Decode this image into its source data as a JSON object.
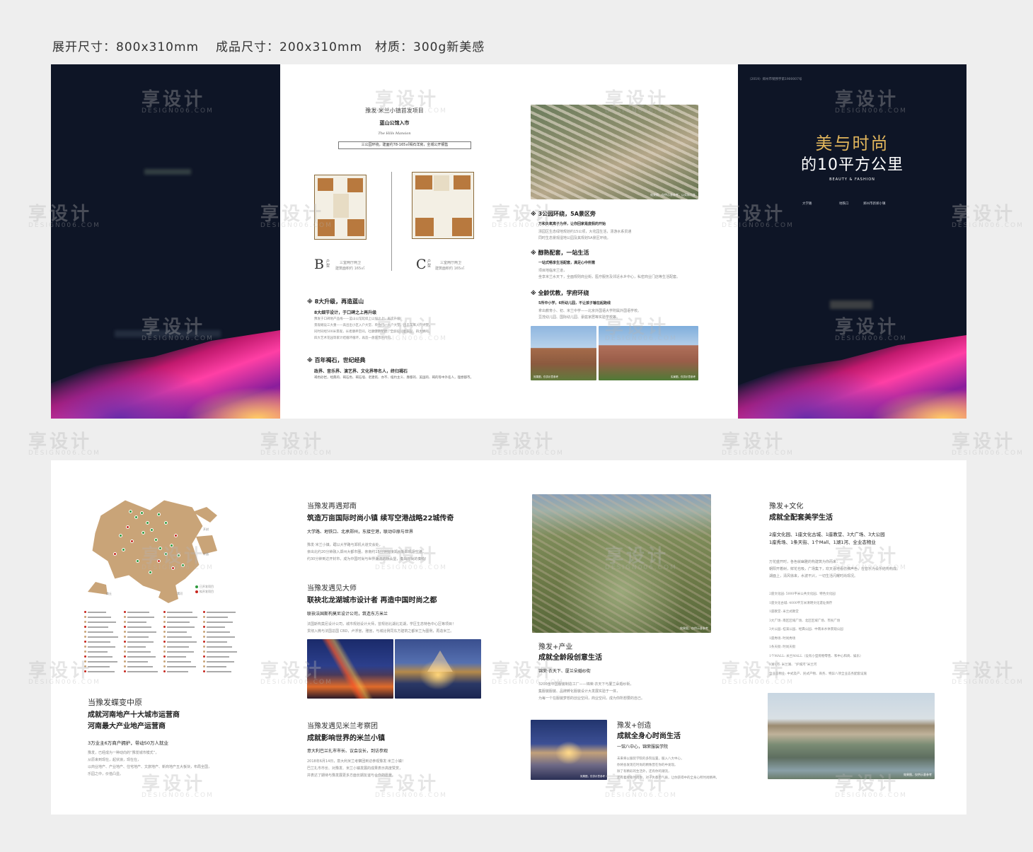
{
  "specs": {
    "expand": "展开尺寸：800x310mm",
    "finished": "成品尺寸：200x310mm",
    "material": "材质：300g新美感"
  },
  "watermark": {
    "brand": "享设计",
    "sub": "DESIGN006.COM"
  },
  "top": {
    "p2": {
      "subtitle": "豫发·米兰小镇首发项目",
      "title": "蓝山公馆入市",
      "script": "The Hills Mansion",
      "banner": "三公园环绕，建面约78-165㎡褐石洋房，全城公开钢售",
      "planB": {
        "letter": "B",
        "type": "户型",
        "desc": "三室两厅两卫",
        "area": "建筑面积约 165㎡"
      },
      "planC": {
        "letter": "C",
        "type": "户型",
        "desc": "三室两厅两卫",
        "area": "建筑面积约 165㎡"
      },
      "sec1": {
        "title": "※ 8大升级，再造蓝山",
        "lead": "8大细节设计，于口碑之上再升级",
        "lines": [
          "豫发于口碑地产品线——蓝山公馆延续上以加之上，再次升级！",
          "景观端设三大重——高出出小区入户大堂、单位门、入户大堂，出于车库入户大堂。",
          "同时同经500米景观，长者康养空间，社康健教配建，全龄段儿童乐园，四大休闲。",
          "四大艺术花园等家计结循环循环，再造一盘城市的内向。"
        ]
      },
      "sec2": {
        "title": "※ 百年褐石，世纪经典",
        "lead": "政界、音乐界、演艺界、文化界等名人，终归褐石",
        "lines": [
          "褐色砂岩，经典的、褐石色、褐石墙、老建筑、亦不、纽约主义、摩都的、美国的、褐的等中外名人，理想都市。"
        ]
      }
    },
    "p3": {
      "caption1": "效果图，仅供示意参考，以实际为准",
      "sec1": {
        "title": "※ 3公园环绕，5A景区旁",
        "lead": "万和负氧离子为伴，让你回家是度假的开始",
        "lines": [
          "漂园区生态绿地规划约15公顷，大花园生活，漂游水系贯通",
          "同时生态景观湿地公园及其规划5A景区环绕。"
        ]
      },
      "sec2": {
        "title": "※ 醇熟配套，一站生活",
        "lead": "一站式畅享生活配套，满足心中所需",
        "lines": [
          "项目地临米兰道，",
          "坐享米兰水天下，全面规则商业街，医疗服务及邻近水乡中心，私密商业门店等生活配套。"
        ]
      },
      "sec3": {
        "title": "※ 全龄优教，学府环绕",
        "lead": "5所中小学，6所幼儿园，不让孩子输在起跑线",
        "lines": [
          "拿出教育小、初、米兰中学——北京外国语大学附属外国语学校。",
          "豆茂幼儿园、国际幼儿园、豪庭家居等实验学校等。"
        ]
      },
      "caption2": "效果图，仅供示意参考",
      "caption3": "实景图，仅供示意参考"
    },
    "p4": {
      "topnote": "（2019）郑州市销预字第1900007号",
      "title1": "美与时尚",
      "title2": "的10平方公里",
      "en": "BEAUTY & FASHION",
      "meta": [
        "大学路",
        "地铁口",
        "郑州市新郑小镇"
      ]
    }
  },
  "bottom": {
    "b1": {
      "map_labels": [
        "开封",
        "许昌",
        "商丘",
        "漯河"
      ],
      "legend": [
        "已开发项目",
        "拟开发项目"
      ],
      "title": "当豫发蝶变中原",
      "line1": "成就河南地产十大城市运营商",
      "line2": "河南最大产业地产运营商",
      "sub": "3万业主6万商户拥护，带动50万人就业",
      "body": [
        "豫发，已经成为一种动向的“豫发城市模式”，",
        "从原来到现在，起伏浪，现在在，",
        "以商业地产、产业地产、住宅地产、文旅地产、新商地产五大板块，布局全国，",
        "乐园之中，价值凸显。"
      ]
    },
    "b2": {
      "s1": {
        "title": "当豫发再遇郑南",
        "sub": "筑造万亩国际时尚小镇  续写空港战略22城传奇",
        "lead": "大学路、地铁口、北承郑州，东接空港，联动中原与世界",
        "lines": [
          "豫发·米兰小镇，踞以大学路与郑机大道交会处，",
          "亲出北约20分钟融入郑州大都市圈，亲南约15分钟衔接郑州新郑机场空港，",
          "约30分钟到达开封市，成为中国时尚与世界潮流的桥头堡，奏出时尚的奏响！"
        ]
      },
      "s2": {
        "title": "当豫发遇见大师",
        "sub": "联袂北龙湖城市设计者  再造中国时尚之都",
        "lead": "联袂法国斯构莫尼设计公司，筑造东方米兰",
        "lines": [
          "法国斯构莫尼设计公司，城市规划设计大师，曾规划北湖北龙湖，学区生态特色中心区等项目！",
          "贯彻入微与法国总国 CBD，卢浮宫，雅宫，与城比例同东方建筑之都米兰为图例，再造米兰。"
        ]
      },
      "s3": {
        "title": "当豫发遇见米兰考察团",
        "sub": "成就影响世界的米兰小镇",
        "lead": "意大利巴兰扎市市长、议会议长，到访参观",
        "lines": [
          "2018年6月14日，意大利米兰考察团到访参观豫发·米兰小镇！",
          "巴兰扎市市长、对豫发、米兰小镇发展的成果表示高度赞赏，",
          "并表达了期待与豫发展更多方面长期友谊与合作的愿景。"
        ]
      }
    },
    "b3": {
      "caption1": "效果图，仅供示意参考",
      "s1": {
        "title": "豫发+产业",
        "sub": "成就全龄段创意生活",
        "lead": "锦荣·衣天下、厦兰朵婚纱街",
        "lines": [
          "3200亩中国服装制造工厂——锦荣·衣天下与厦兰朵婚纱街，",
          "集服装服装、品牌孵化服装设计大发展实验于一体，",
          "为每一个在服装梦想的创业空间，商业空间，成为你所想要的自己。"
        ]
      },
      "s2": {
        "title": "豫发+创造",
        "sub": "成就全身心时尚生活",
        "lead": "一馆八中心，锦荣服装学院",
        "lines": [
          "未来将以服装学院的多院设置，服入八大中心，",
          "你将会发现在时尚的精致曾在你的中发现。",
          "除了有精彩的生活外，还有你的潮流，",
          "还有着顺处时尚你，对于大都市气质，让你获得中的全身心所时尚精神。"
        ]
      },
      "caption2": "效果图，仅供示意参考"
    },
    "b4": {
      "title": "豫发+文化",
      "sub": "成就全配套美学生活",
      "lead": [
        "2座文化园、1座文化古城、1座教堂、3大广场、3大公园",
        "1座秀场、1条天街、1个Mall、1湖1河、全业态物业"
      ],
      "intro": [
        "万花盛开时，各色就幽雅的构建筑为你而来：",
        "朝阳开着树，鲜花也吸，广场集下，欢天喜地看仿佛声色，在音乐为设乐结构构成。",
        "湖面上，清风徐来，水波不兴，一切生活闪耀时尚现况。"
      ],
      "items": [
        "2座文化园: 5000平米公共文化园、特色文化园",
        "1座文化古城: 4000平方米清明文化遗址保存",
        "1座教堂: 米兰式教堂",
        "3大广场: 南区区域广场、北区区域广场、市民广场",
        "3大公园: 桂溪公园、经典公园、中南米水体景观公园",
        "1座秀场: 时尚秀场",
        "1条天街: 时尚天街",
        "1个MALL: 米兰MALL（设有小型购物零售、和中心和商、娱乐）",
        "1湖1河: 米兰湖、“护城河”米兰河",
        "全业态物业: 中式及产、民式产物、商务、特异八项全业态务配套设施"
      ],
      "caption": "效果图，仅供示意参考"
    }
  },
  "colors": {
    "navy": "#0e1526",
    "gold": "#e2b65c",
    "mapTan": "#c9a478",
    "greenDot": "#2e9a3e",
    "redDot": "#c8261e"
  }
}
